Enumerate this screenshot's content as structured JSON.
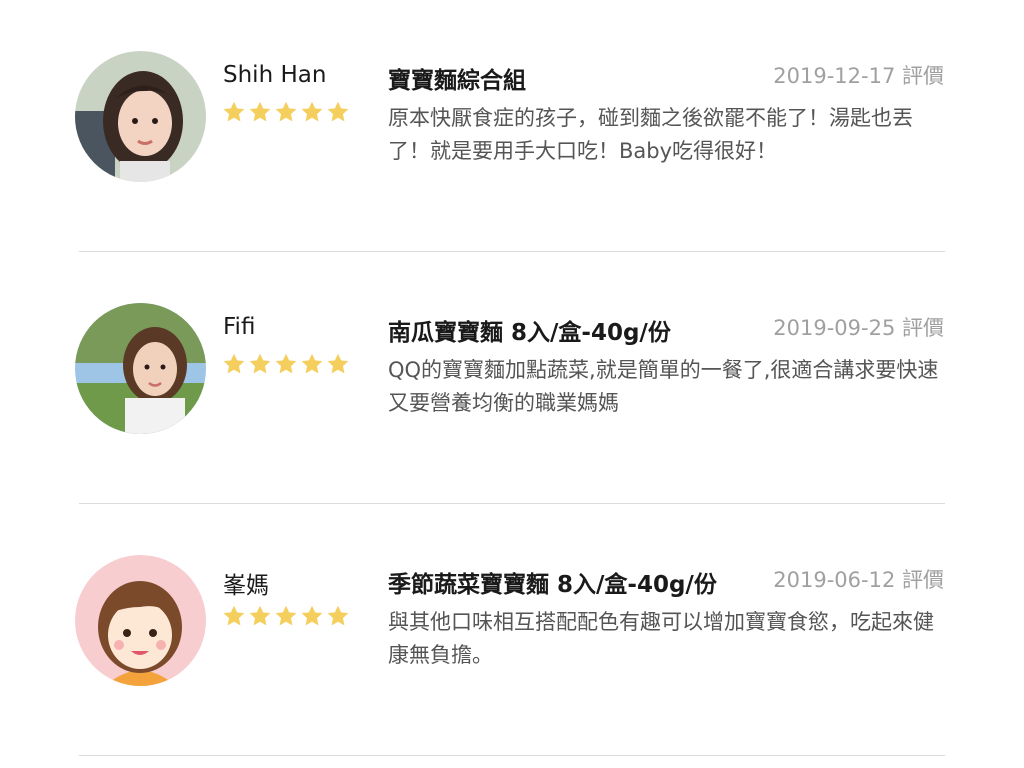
{
  "reviews": [
    {
      "reviewer": "Shih Han",
      "stars": 5,
      "product": "寶寶麵綜合組",
      "date": "2019-12-17 評價",
      "text": "原本快厭食症的孩子，碰到麵之後欲罷不能了！湯匙也丟了！就是要用手大口吃！Baby吃得很好！",
      "avatar": "photo-avatar"
    },
    {
      "reviewer": "Fifi",
      "stars": 5,
      "product": "南瓜寶寶麵 8入/盒-40g/份",
      "date": "2019-09-25 評價",
      "text": "QQ的寶寶麵加點蔬菜,就是簡單的一餐了,很適合講求要快速又要營養均衡的職業媽媽",
      "avatar": "photo-avatar"
    },
    {
      "reviewer": "峯媽",
      "stars": 5,
      "product": "季節蔬菜寶寶麵 8入/盒-40g/份",
      "date": "2019-06-12 評價",
      "text": "與其他口味相互搭配配色有趣可以增加寶寶食慾，吃起來健康無負擔。",
      "avatar": "cartoon-avatar"
    }
  ],
  "colors": {
    "star": "#f4cf5d",
    "date": "#a0a0a0",
    "text": "#555555",
    "divider": "#dcdcdc",
    "cartoon_bg": "#f8cdd0"
  }
}
